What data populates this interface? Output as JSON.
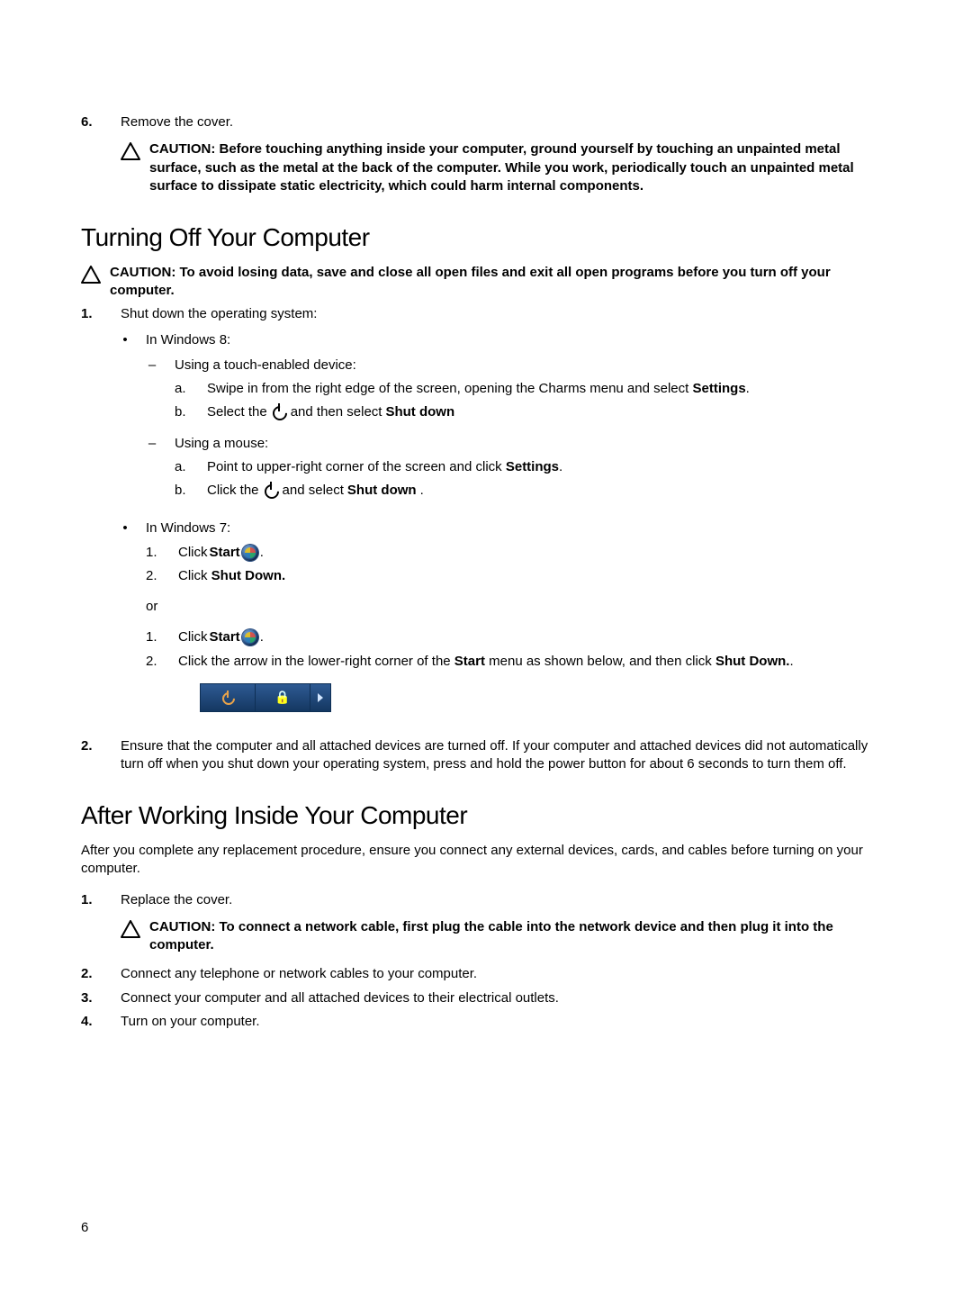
{
  "page_number": "6",
  "item6": {
    "num": "6.",
    "text": "Remove the cover."
  },
  "caution1": "CAUTION: Before touching anything inside your computer, ground yourself by touching an unpainted metal surface, such as the metal at the back of the computer. While you work, periodically touch an unpainted metal surface to dissipate static electricity, which could harm internal components.",
  "section1_title": "Turning Off Your Computer",
  "caution2": "CAUTION: To avoid losing data, save and close all open files and exit all open programs before you turn off your computer.",
  "s1_item1": {
    "num": "1.",
    "text": "Shut down the operating system:"
  },
  "win8_label": "In Windows 8:",
  "touch_label": "Using a touch-enabled device:",
  "touch_a": {
    "a": "a.",
    "pre": "Swipe in from the right edge of the screen, opening the Charms menu and select ",
    "bold": "Settings",
    "post": "."
  },
  "touch_b": {
    "a": "b.",
    "pre": "Select the ",
    "mid": " and then select ",
    "bold": "Shut down"
  },
  "mouse_label": "Using a mouse:",
  "mouse_a": {
    "a": "a.",
    "pre": "Point to upper-right corner of the screen and click ",
    "bold": "Settings",
    "post": "."
  },
  "mouse_b": {
    "a": "b.",
    "pre": "Click the ",
    "mid": " and select ",
    "bold": "Shut down",
    "post": "."
  },
  "win7_label": "In Windows 7:",
  "w7a_1": {
    "n": "1.",
    "pre": "Click ",
    "bold": "Start",
    "post": " ."
  },
  "w7a_2": {
    "n": "2.",
    "pre": "Click ",
    "bold": "Shut Down."
  },
  "or_text": "or",
  "w7b_1": {
    "n": "1.",
    "pre": "Click ",
    "bold": "Start",
    "post": " ."
  },
  "w7b_2": {
    "n": "2.",
    "pre": "Click the arrow in the lower-right corner of the ",
    "bold1": "Start",
    "mid": " menu as shown below, and then click ",
    "bold2": "Shut Down.",
    "post": "."
  },
  "s1_item2": {
    "num": "2.",
    "text": "Ensure that the computer and all attached devices are turned off. If your computer and attached devices did not automatically turn off when you shut down your operating system, press and hold the power button for about 6 seconds to turn them off."
  },
  "section2_title": "After Working Inside Your Computer",
  "s2_intro": "After you complete any replacement procedure, ensure you connect any external devices, cards, and cables before turning on your computer.",
  "s2_item1": {
    "num": "1.",
    "text": "Replace the cover."
  },
  "caution3": "CAUTION: To connect a network cable, first plug the cable into the network device and then plug it into the computer.",
  "s2_item2": {
    "num": "2.",
    "text": "Connect any telephone or network cables to your computer."
  },
  "s2_item3": {
    "num": "3.",
    "text": "Connect your computer and all attached devices to their electrical outlets."
  },
  "s2_item4": {
    "num": "4.",
    "text": "Turn on your computer."
  }
}
